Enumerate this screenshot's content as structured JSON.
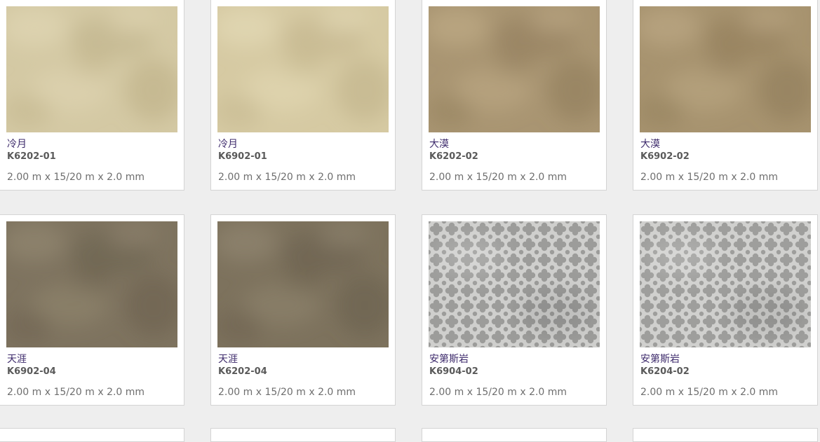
{
  "products": [
    {
      "name": "冷月",
      "code": "K6202-01",
      "size": "2.00 m x 15/20 m x 2.0 mm",
      "texture": "marble",
      "colors": {
        "base": "#d4c9a4",
        "dark": "#b9ab82",
        "light": "#e0d6b3"
      }
    },
    {
      "name": "冷月",
      "code": "K6902-01",
      "size": "2.00 m x 15/20 m x 2.0 mm",
      "texture": "marble",
      "colors": {
        "base": "#d6caa3",
        "dark": "#bcae86",
        "light": "#e3d9b5"
      }
    },
    {
      "name": "大漠",
      "code": "K6202-02",
      "size": "2.00 m x 15/20 m x 2.0 mm",
      "texture": "marble",
      "colors": {
        "base": "#a99572",
        "dark": "#8c7857",
        "light": "#bda985"
      }
    },
    {
      "name": "大漠",
      "code": "K6902-02",
      "size": "2.00 m x 15/20 m x 2.0 mm",
      "texture": "marble",
      "colors": {
        "base": "#a7936f",
        "dark": "#8b7755",
        "light": "#bba783"
      }
    },
    {
      "name": "天涯",
      "code": "K6902-04",
      "size": "2.00 m x 15/20 m x 2.0 mm",
      "texture": "marble",
      "colors": {
        "base": "#7e735f",
        "dark": "#675d4a",
        "light": "#918670"
      }
    },
    {
      "name": "天涯",
      "code": "K6202-04",
      "size": "2.00 m x 15/20 m x 2.0 mm",
      "texture": "marble",
      "colors": {
        "base": "#7d725d",
        "dark": "#665c49",
        "light": "#908570"
      }
    },
    {
      "name": "安第斯岩",
      "code": "K6904-02",
      "size": "2.00 m x 15/20 m x 2.0 mm",
      "texture": "quatrefoil",
      "colors": {
        "base": "#b4b4b2",
        "dark": "#9c9c9a",
        "light": "#cfcfcd"
      }
    },
    {
      "name": "安第斯岩",
      "code": "K6204-02",
      "size": "2.00 m x 15/20 m x 2.0 mm",
      "texture": "quatrefoil",
      "colors": {
        "base": "#b6b6b4",
        "dark": "#9e9e9c",
        "light": "#d0d0ce"
      }
    }
  ]
}
